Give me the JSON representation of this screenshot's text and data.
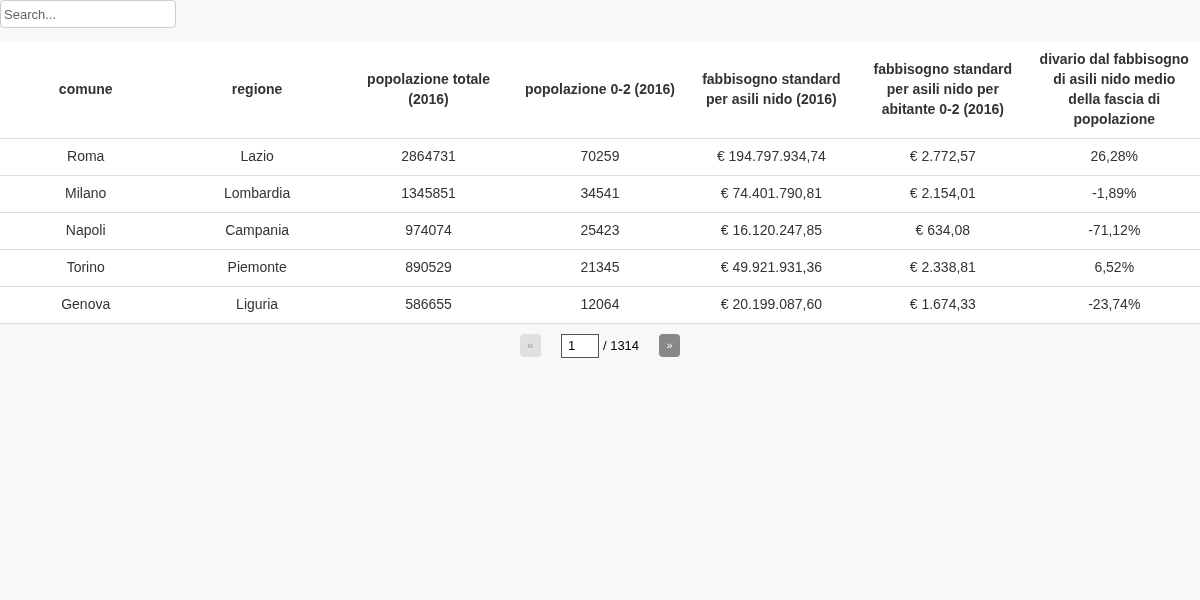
{
  "search": {
    "placeholder": "Search..."
  },
  "table": {
    "columns": [
      "comune",
      "regione",
      "popolazione totale (2016)",
      "popolazione 0-2 (2016)",
      "fabbisogno standard per asili nido (2016)",
      "fabbisogno standard per asili nido per abitante 0-2 (2016)",
      "divario dal fabbisogno di asili nido medio della fascia di popolazione"
    ],
    "rows": [
      [
        "Roma",
        "Lazio",
        "2864731",
        "70259",
        "€ 194.797.934,74",
        "€ 2.772,57",
        "26,28%"
      ],
      [
        "Milano",
        "Lombardia",
        "1345851",
        "34541",
        "€ 74.401.790,81",
        "€ 2.154,01",
        "-1,89%"
      ],
      [
        "Napoli",
        "Campania",
        "974074",
        "25423",
        "€ 16.120.247,85",
        "€ 634,08",
        "-71,12%"
      ],
      [
        "Torino",
        "Piemonte",
        "890529",
        "21345",
        "€ 49.921.931,36",
        "€ 2.338,81",
        "6,52%"
      ],
      [
        "Genova",
        "Liguria",
        "586655",
        "12064",
        "€ 20.199.087,60",
        "€ 1.674,33",
        "-23,74%"
      ]
    ]
  },
  "pagination": {
    "prev": {
      "label": "«",
      "disabled": true
    },
    "page": "1",
    "total": "/ 1314",
    "next": {
      "label": "»",
      "disabled": false
    }
  }
}
